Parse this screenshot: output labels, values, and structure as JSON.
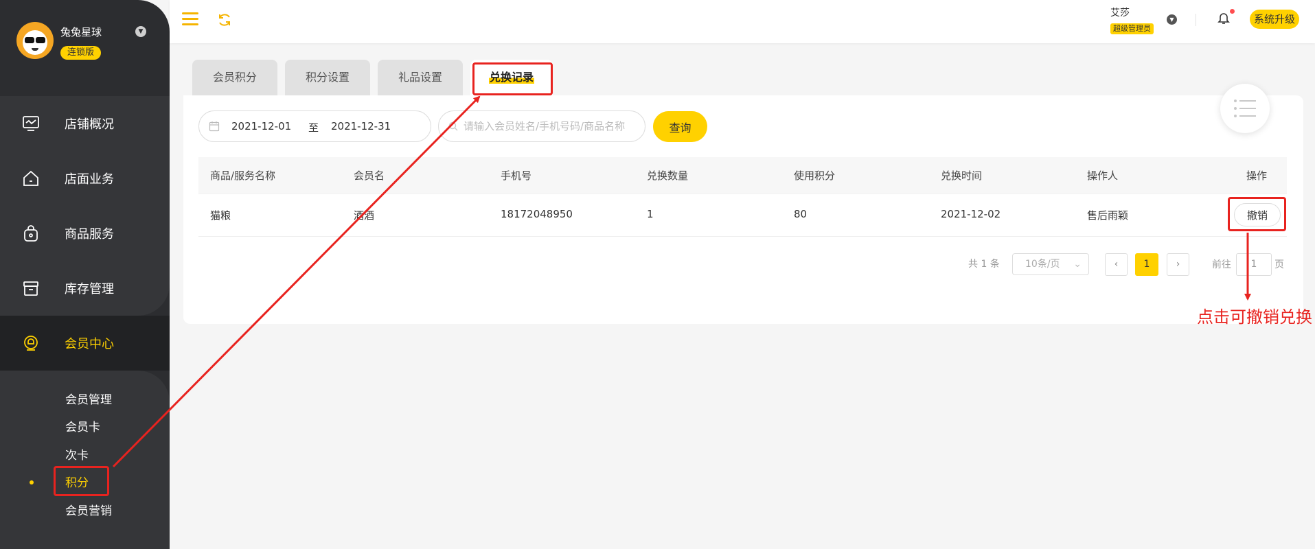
{
  "sidebar": {
    "store_name": "兔兔星球",
    "edition": "连锁版",
    "nav": [
      {
        "label": "店铺概况",
        "icon": "monitor-icon"
      },
      {
        "label": "店面业务",
        "icon": "home-icon"
      },
      {
        "label": "商品服务",
        "icon": "bag-icon"
      },
      {
        "label": "库存管理",
        "icon": "box-icon"
      },
      {
        "label": "会员中心",
        "icon": "member-icon"
      }
    ],
    "sub_nav": [
      {
        "label": "会员管理"
      },
      {
        "label": "会员卡"
      },
      {
        "label": "次卡"
      },
      {
        "label": "积分"
      },
      {
        "label": "会员营销"
      }
    ]
  },
  "header": {
    "user_name": "艾莎",
    "role": "超级管理员",
    "upgrade_label": "系统升级"
  },
  "tabs": [
    {
      "label": "会员积分"
    },
    {
      "label": "积分设置"
    },
    {
      "label": "礼品设置"
    },
    {
      "label": "兑换记录"
    }
  ],
  "filters": {
    "date_start": "2021-12-01",
    "date_sep": "至",
    "date_end": "2021-12-31",
    "search_placeholder": "请输入会员姓名/手机号码/商品名称",
    "query_label": "查询"
  },
  "table": {
    "columns": [
      "商品/服务名称",
      "会员名",
      "手机号",
      "兑换数量",
      "使用积分",
      "兑换时间",
      "操作人",
      "操作"
    ],
    "rows": [
      {
        "cells": [
          "猫粮",
          "酒酒",
          "18172048950",
          "1",
          "80",
          "2021-12-02",
          "售后雨颖"
        ],
        "action": "撤销"
      }
    ]
  },
  "pagination": {
    "total": "共 1 条",
    "page_size": "10条/页",
    "current": "1",
    "goto_label": "前往",
    "goto_value": "1",
    "page_suffix": "页"
  },
  "annotation": {
    "note": "点击可撤销兑换",
    "color": "#e8231f"
  },
  "colors": {
    "accent": "#ffd100",
    "sidebar_bg": "#2c2d30"
  }
}
